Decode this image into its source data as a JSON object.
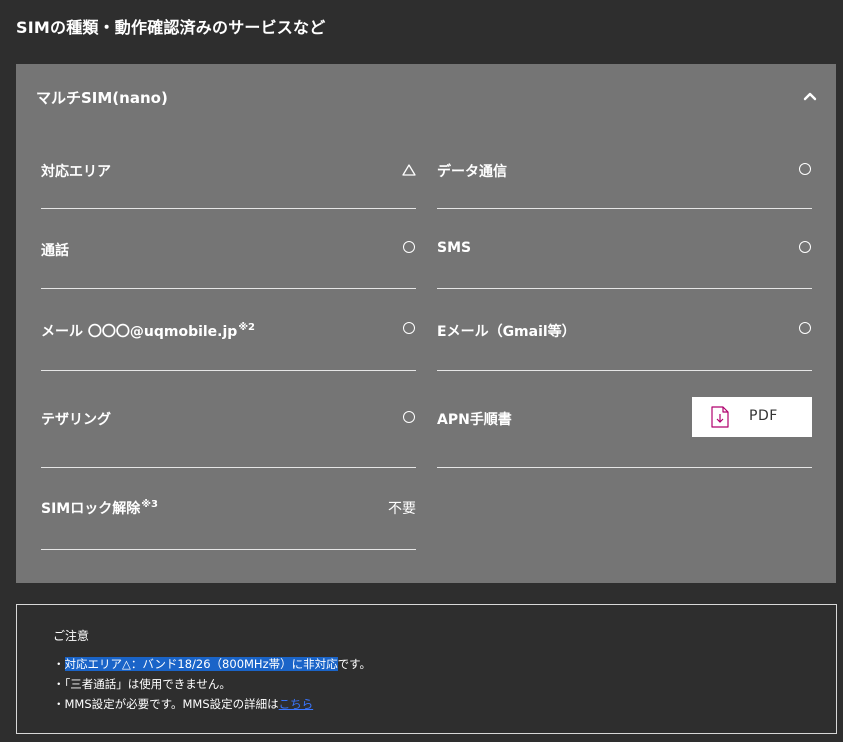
{
  "page_title": "SIMの種類・動作確認済みのサービスなど",
  "card": {
    "title": "マルチSIM(nano)",
    "collapse_icon": "chevron-up-icon",
    "left_column": [
      {
        "label": "対応エリア",
        "mark": "△"
      },
      {
        "label": "通話",
        "mark": "○"
      },
      {
        "label": "メール 〇〇〇@uqmobile.jp",
        "sup": "※2",
        "mark": "○"
      },
      {
        "label": "テザリング",
        "mark": "○"
      },
      {
        "label": "SIMロック解除",
        "sup": "※3",
        "value": "不要"
      }
    ],
    "right_column": [
      {
        "label": "データ通信",
        "mark": "○"
      },
      {
        "label": "SMS",
        "mark": "○"
      },
      {
        "label": "Eメール（Gmail等）",
        "mark": "○"
      },
      {
        "label": "APN手順書",
        "button_label": "PDF",
        "button_icon": "pdf-download-icon"
      }
    ]
  },
  "notice": {
    "title": "ご注意",
    "line1_prefix": "・",
    "line1_highlight": "対応エリア△：バンド18/26（800MHz帯）に非対応",
    "line1_suffix": "です。",
    "line2": "・「三者通話」は使用できません。",
    "line3_text": "・MMS設定が必要です。MMS設定の詳細は",
    "line3_link": "こちら"
  },
  "colors": {
    "background": "#2e2e2e",
    "card": "#757575",
    "highlight": "#1a64c8",
    "link": "#3a76ff",
    "pdf_icon": "#b0006e"
  }
}
